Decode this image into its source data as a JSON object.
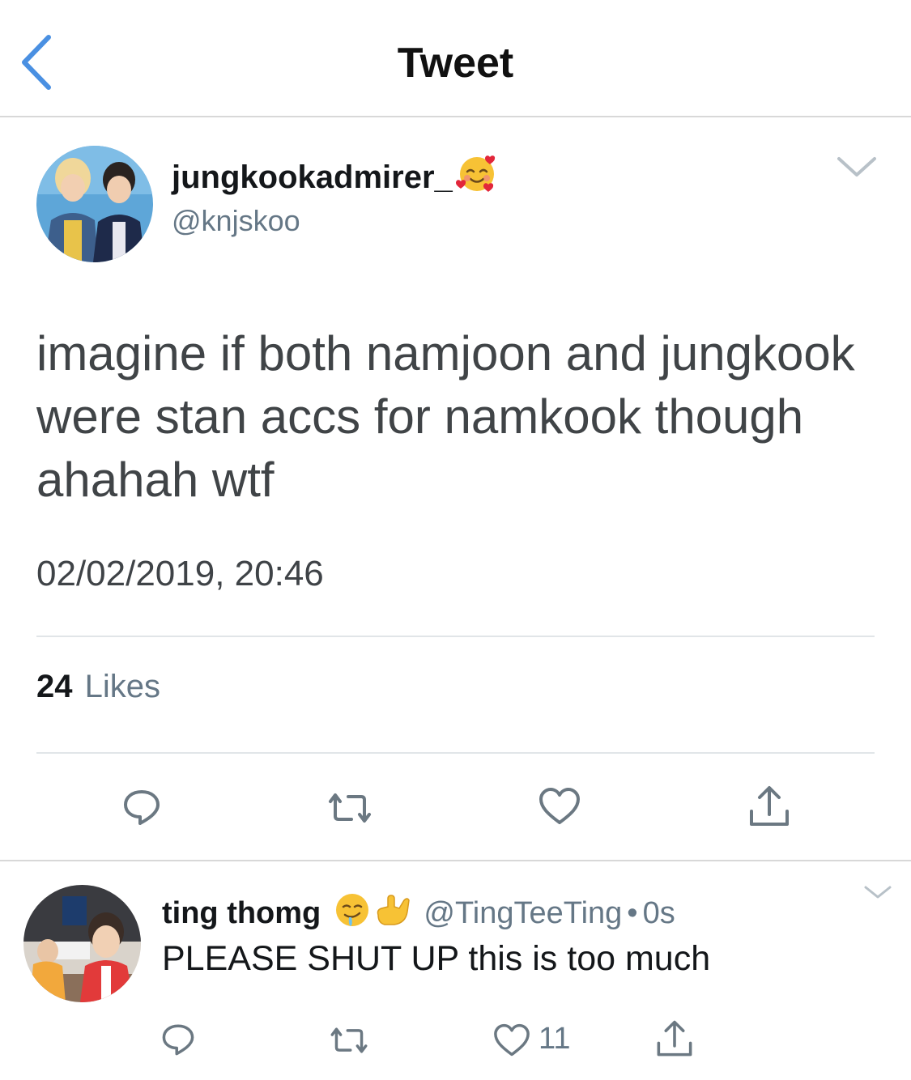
{
  "header": {
    "title": "Tweet",
    "back_icon": "chevron-left-icon",
    "accent_color": "#4a90e2"
  },
  "tweet": {
    "display_name": "jungkookadmirer_",
    "name_emoji": "smiling-face-with-hearts-emoji",
    "handle": "@knjskoo",
    "text": "imagine if both namjoon and jungkook were stan accs for namkook though ahahah wtf",
    "timestamp": "02/02/2019, 20:46",
    "likes_count": "24",
    "likes_label": "Likes",
    "actions": [
      "reply-icon",
      "retweet-icon",
      "heart-icon",
      "share-icon"
    ]
  },
  "reply": {
    "display_name": "ting thomg",
    "name_emojis": [
      "drooling-face-emoji",
      "call-me-hand-emoji"
    ],
    "handle": "@TingTeeTing",
    "separator": "•",
    "time": "0s",
    "text": "PLEASE SHUT UP this is too much",
    "like_count": "11",
    "actions": [
      "reply-icon",
      "retweet-icon",
      "heart-icon",
      "share-icon"
    ]
  },
  "colors": {
    "text": "#14171a",
    "muted": "#657786",
    "icon": "#6b7882",
    "divider": "#e1e5e8"
  }
}
